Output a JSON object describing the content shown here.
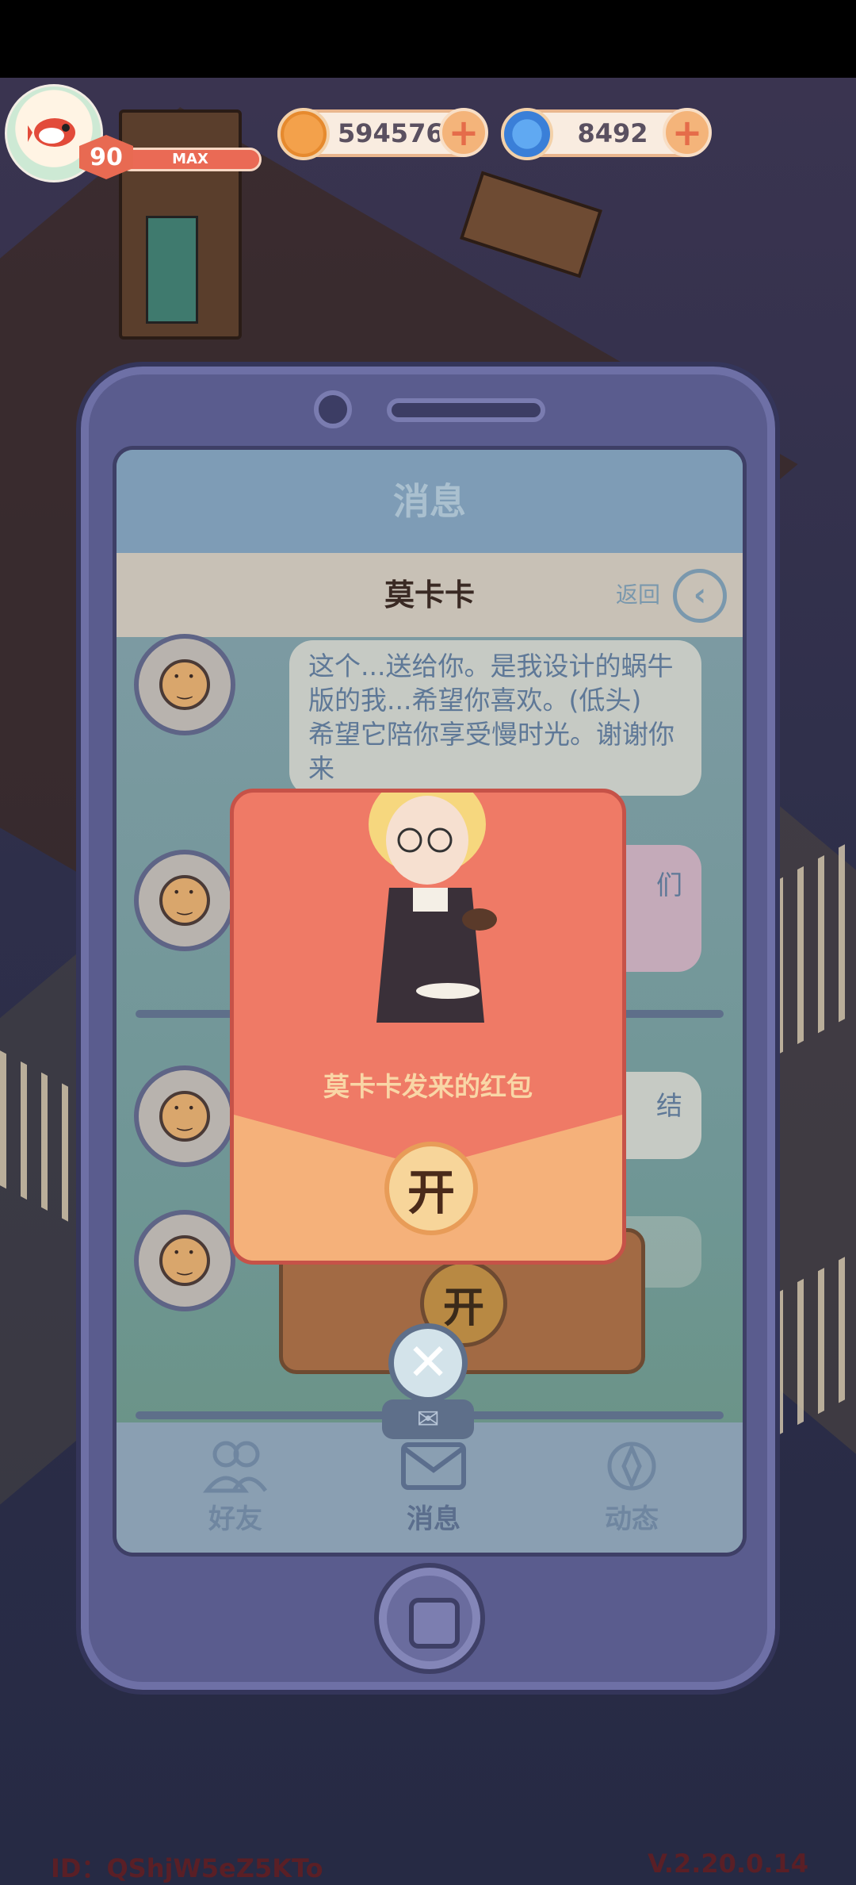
{
  "hud": {
    "level": "90",
    "exp_label": "MAX",
    "exp_progress": 1.0,
    "coins": "594576",
    "gems": "8492",
    "coin_plus": "+",
    "gem_plus": "+"
  },
  "phone": {
    "screen_title": "消息",
    "chat_title": "莫卡卡",
    "back_label": "返回",
    "back_icon": "‹",
    "messages": [
      {
        "text": "这个...送给你。是我设计的蜗牛版的我...希望你喜欢。(低头)\n希望它陪你享受慢时光。谢谢你来"
      },
      {
        "text": "们"
      },
      {
        "text": "结"
      },
      {
        "text": ""
      }
    ],
    "tabs": [
      {
        "label": "好友",
        "icon": "friends-icon"
      },
      {
        "label": "消息",
        "icon": "mail-icon"
      },
      {
        "label": "动态",
        "icon": "moments-icon"
      }
    ]
  },
  "envelope": {
    "from_text": "莫卡卡发来的红包",
    "open_label": "开",
    "back_open_label": "开",
    "close_label": "✕",
    "mail_glyph": "✉"
  },
  "footer": {
    "id_text": "ID：QShjW5eZ5KTo",
    "version_text": "V.2.20.0.14"
  },
  "colors": {
    "envelope_red": "#ef7a66",
    "envelope_flap": "#f5b17a",
    "phone_body": "#5a5c8e"
  }
}
